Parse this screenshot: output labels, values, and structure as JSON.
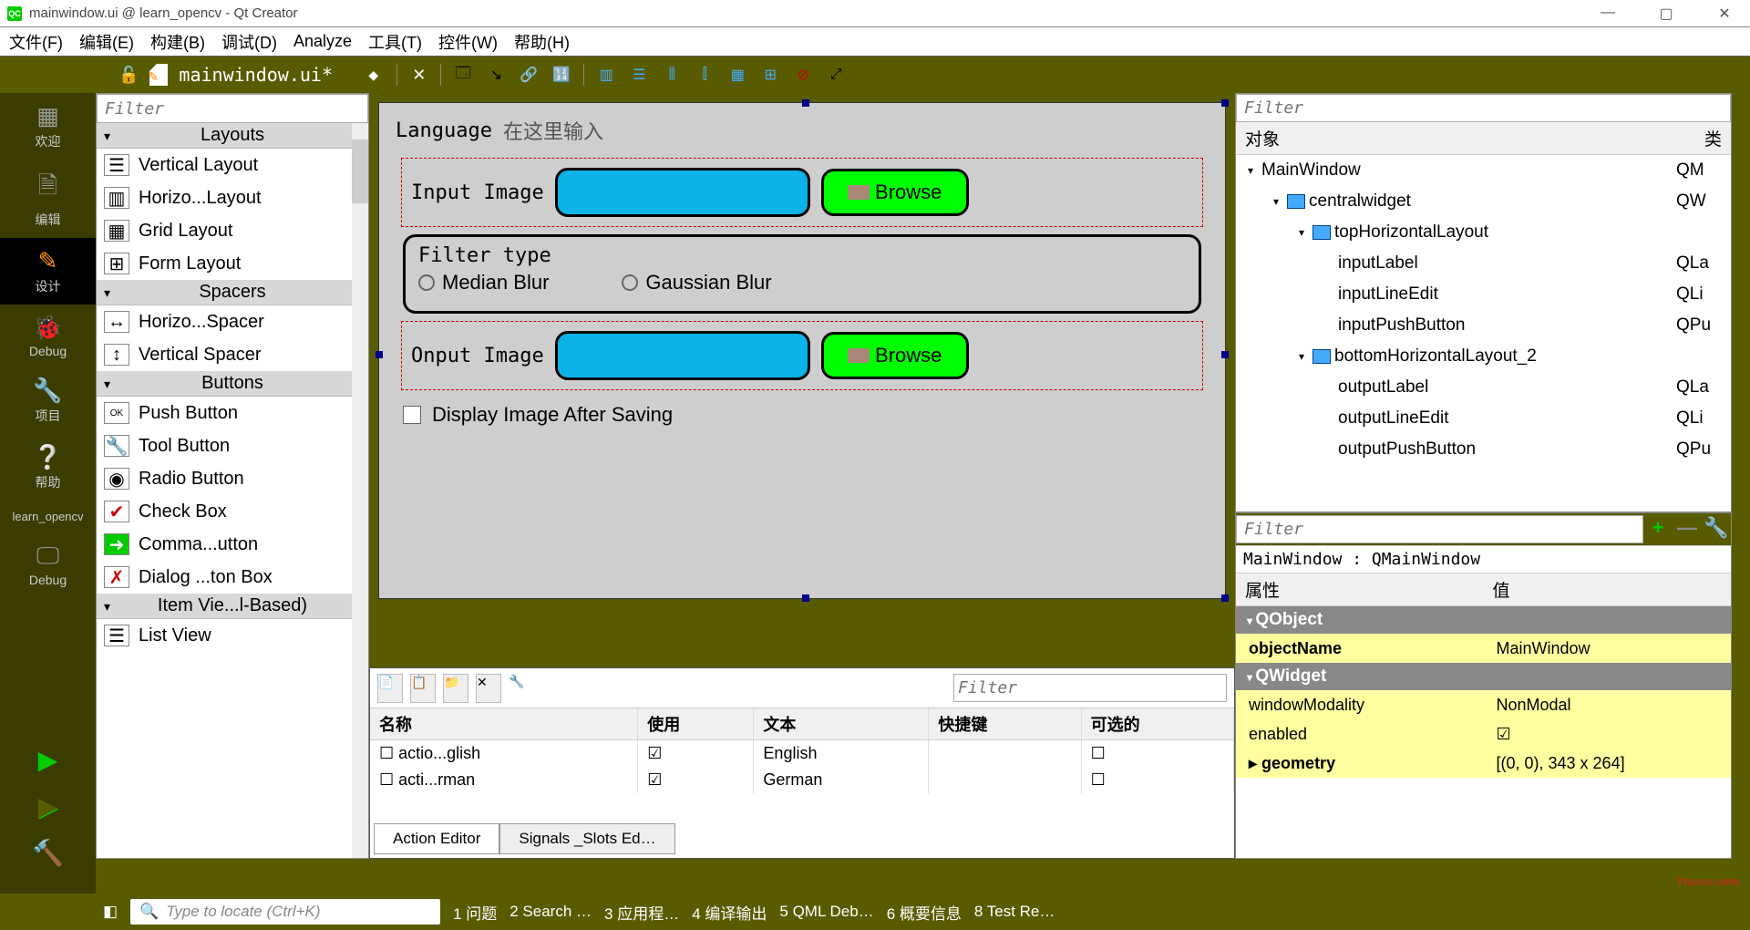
{
  "window": {
    "title": "mainwindow.ui @ learn_opencv - Qt Creator",
    "filename": "mainwindow.ui*"
  },
  "menu": {
    "file": "文件(F)",
    "edit": "编辑(E)",
    "build": "构建(B)",
    "debug": "调试(D)",
    "analyze": "Analyze",
    "tools": "工具(T)",
    "widgets": "控件(W)",
    "help": "帮助(H)"
  },
  "activity": {
    "welcome": "欢迎",
    "edit": "编辑",
    "design": "设计",
    "debug": "Debug",
    "project": "项目",
    "help": "帮助",
    "kit": "learn_opencv",
    "debug2": "Debug"
  },
  "widgetbox": {
    "filter_placeholder": "Filter",
    "groups": {
      "layouts": "Layouts",
      "spacers": "Spacers",
      "buttons": "Buttons",
      "itemviews": "Item Vie...l-Based)"
    },
    "items": {
      "vlayout": "Vertical Layout",
      "hlayout": "Horizo...Layout",
      "grid": "Grid Layout",
      "form": "Form Layout",
      "hspacer": "Horizo...Spacer",
      "vspacer": "Vertical Spacer",
      "pushbtn": "Push Button",
      "toolbtn": "Tool Button",
      "radiobtn": "Radio Button",
      "checkbox": "Check Box",
      "cmdlink": "Comma...utton",
      "dialogbox": "Dialog ...ton Box",
      "listview": "List View"
    }
  },
  "form": {
    "language_lbl": "Language",
    "language_placeholder": "在这里输入",
    "input_lbl": "Input Image",
    "output_lbl": "Onput Image",
    "browse": "Browse",
    "filter_group": "Filter type",
    "median": "Median Blur",
    "gaussian": "Gaussian Blur",
    "display_check": "Display Image After Saving"
  },
  "action_editor": {
    "filter_placeholder": "Filter",
    "headers": {
      "name": "名称",
      "use": "使用",
      "text": "文本",
      "shortcut": "快捷键",
      "checkable": "可选的"
    },
    "rows": [
      {
        "name": "actio...glish",
        "checked": true,
        "text": "English"
      },
      {
        "name": "acti...rman",
        "checked": true,
        "text": "German"
      }
    ],
    "tabs": {
      "action": "Action Editor",
      "signals": "Signals _Slots Ed…"
    }
  },
  "inspector": {
    "filter_placeholder": "Filter",
    "headers": {
      "object": "对象",
      "class": "类"
    },
    "tree": [
      {
        "indent": 0,
        "expand": "▾",
        "name": "MainWindow",
        "cls": "QM"
      },
      {
        "indent": 1,
        "expand": "▾",
        "icon": "layout",
        "name": "centralwidget",
        "cls": "QW"
      },
      {
        "indent": 2,
        "expand": "▾",
        "icon": "hlayout",
        "name": "topHorizontalLayout",
        "cls": ""
      },
      {
        "indent": 3,
        "expand": "",
        "name": "inputLabel",
        "cls": "QLa"
      },
      {
        "indent": 3,
        "expand": "",
        "name": "inputLineEdit",
        "cls": "QLi"
      },
      {
        "indent": 3,
        "expand": "",
        "name": "inputPushButton",
        "cls": "QPu"
      },
      {
        "indent": 2,
        "expand": "▾",
        "icon": "hlayout",
        "name": "bottomHorizontalLayout_2",
        "cls": ""
      },
      {
        "indent": 3,
        "expand": "",
        "name": "outputLabel",
        "cls": "QLa"
      },
      {
        "indent": 3,
        "expand": "",
        "name": "outputLineEdit",
        "cls": "QLi"
      },
      {
        "indent": 3,
        "expand": "",
        "name": "outputPushButton",
        "cls": "QPu"
      }
    ]
  },
  "properties": {
    "filter_placeholder": "Filter",
    "path": "MainWindow : QMainWindow",
    "headers": {
      "prop": "属性",
      "value": "值"
    },
    "groups": {
      "qobject": "QObject",
      "qwidget": "QWidget"
    },
    "rows": {
      "objectName": {
        "label": "objectName",
        "value": "MainWindow"
      },
      "windowModality": {
        "label": "windowModality",
        "value": "NonModal"
      },
      "enabled": {
        "label": "enabled",
        "value": "✓"
      },
      "geometry": {
        "label": "geometry",
        "value": "[(0, 0), 343 x 264]"
      }
    }
  },
  "status": {
    "locate": "Type to locate (Ctrl+K)",
    "items": [
      "1 问题",
      "2 Search …",
      "3 应用程…",
      "4 编译输出",
      "5 QML Deb…",
      "6 概要信息",
      "8 Test Re…"
    ]
  },
  "watermark": "Yuucn.com"
}
